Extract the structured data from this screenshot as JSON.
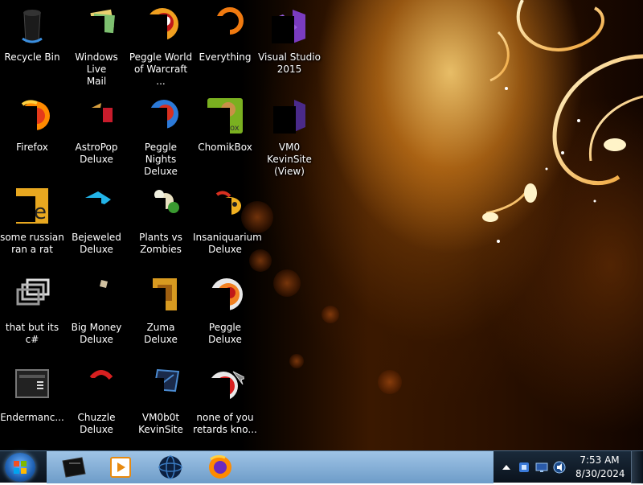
{
  "desktop": {
    "icons": [
      {
        "label": "Recycle Bin",
        "icon": "recycle-bin-icon"
      },
      {
        "label": "Windows Live\nMail",
        "icon": "windows-live-mail-icon"
      },
      {
        "label": "Peggle World\nof Warcraft ...",
        "icon": "peggle-world-of-warcraft-icon"
      },
      {
        "label": "Everything",
        "icon": "everything-icon"
      },
      {
        "label": "Visual Studio\n2015",
        "icon": "visual-studio-icon"
      },
      {
        "label": "Firefox",
        "icon": "firefox-icon"
      },
      {
        "label": "AstroPop\nDeluxe",
        "icon": "astropop-icon"
      },
      {
        "label": "Peggle Nights\nDeluxe",
        "icon": "peggle-nights-icon"
      },
      {
        "label": "ChomikBox",
        "icon": "chomikbox-icon"
      },
      {
        "label": "VM0 KevinSite\n(View)",
        "icon": "vm0-kevinsite-view-icon"
      },
      {
        "label": "some russian\nran a rat",
        "icon": "some-russian-ran-a-rat-icon"
      },
      {
        "label": "Bejeweled\nDeluxe",
        "icon": "bejeweled-icon"
      },
      {
        "label": "Plants vs\nZombies",
        "icon": "plants-vs-zombies-icon"
      },
      {
        "label": "Insaniquarium\nDeluxe",
        "icon": "insaniquarium-icon"
      },
      {
        "label": "that but its c#",
        "icon": "that-but-its-csharp-icon"
      },
      {
        "label": "Big Money\nDeluxe",
        "icon": "big-money-icon"
      },
      {
        "label": "Zuma Deluxe",
        "icon": "zuma-icon"
      },
      {
        "label": "Peggle Deluxe",
        "icon": "peggle-deluxe-icon"
      },
      {
        "label": "Endermanc...",
        "icon": "endermanch-icon"
      },
      {
        "label": "Chuzzle\nDeluxe",
        "icon": "chuzzle-icon"
      },
      {
        "label": "VM0b0t\nKevinSite",
        "icon": "vm0b0t-kevinsite-icon"
      },
      {
        "label": "none of you\nretards kno...",
        "icon": "none-of-you-icon"
      }
    ]
  },
  "taskbar": {
    "start_icon": "windows-start-icon",
    "pinned": [
      {
        "icon": "console-app-icon"
      },
      {
        "icon": "media-player-icon"
      },
      {
        "icon": "globe-app-icon"
      },
      {
        "icon": "firefox-icon"
      }
    ],
    "tray_icons": [
      "show-hidden-icons-icon",
      "network-icon",
      "display-icon",
      "volume-icon"
    ],
    "clock": {
      "time": "7:53 AM",
      "date": "8/30/2024"
    }
  }
}
